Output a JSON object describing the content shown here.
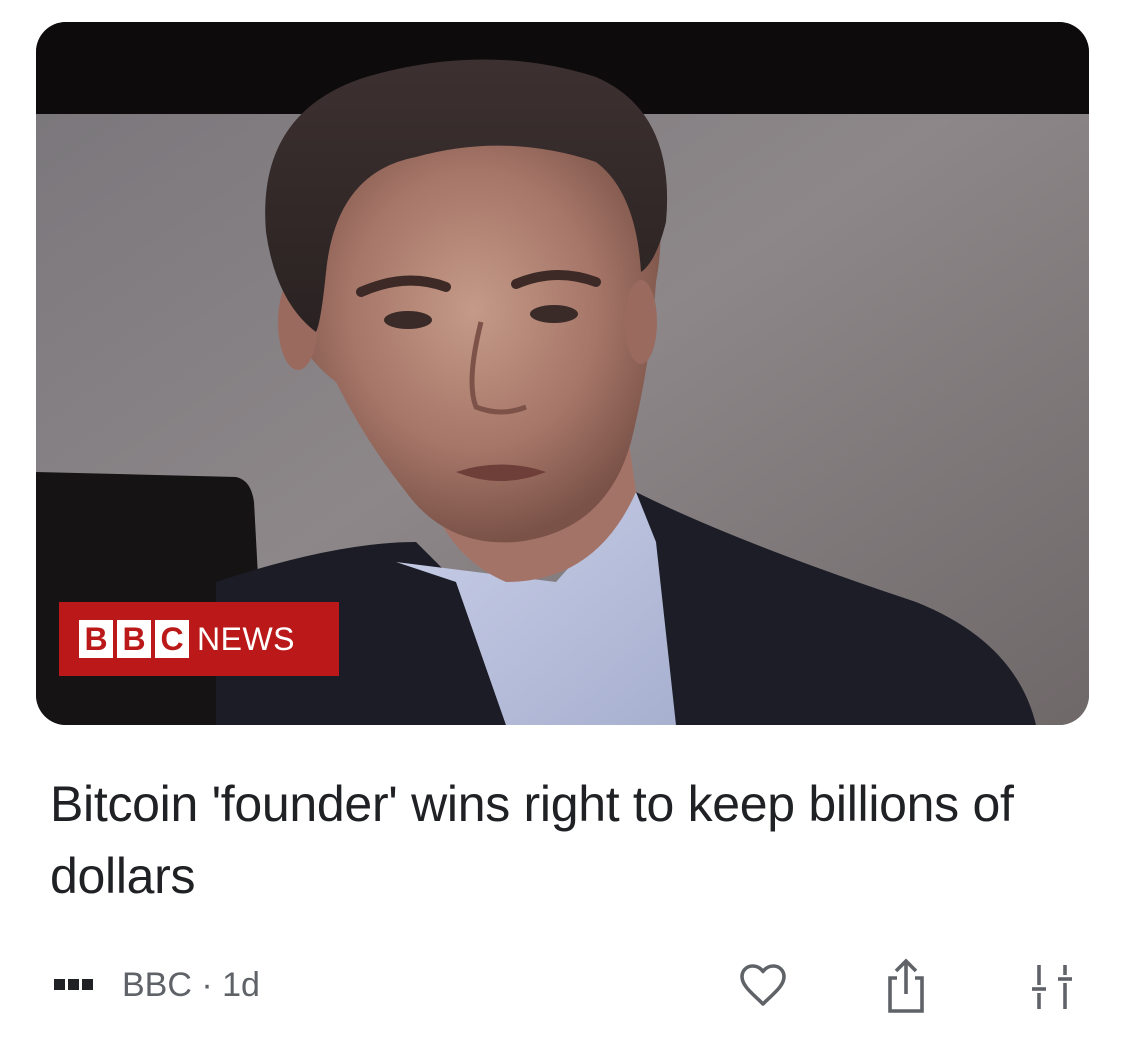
{
  "image": {
    "icon": "news-photo",
    "logo_bbc_letters": [
      "B",
      "B",
      "C"
    ],
    "logo_news_text": "NEWS",
    "logo_color": "#bb1919"
  },
  "article": {
    "headline": "Bitcoin 'founder' wins right to keep billions of dollars"
  },
  "meta": {
    "source_logo_icon": "publisher-logo-icon",
    "source_line": "BBC · 1d"
  },
  "actions": {
    "like_icon": "heart-outline-icon",
    "share_icon": "share-icon",
    "more_icon": "tune-icon"
  },
  "colors": {
    "text_primary": "#202124",
    "text_secondary": "#5f6368",
    "icon": "#5f6368"
  }
}
